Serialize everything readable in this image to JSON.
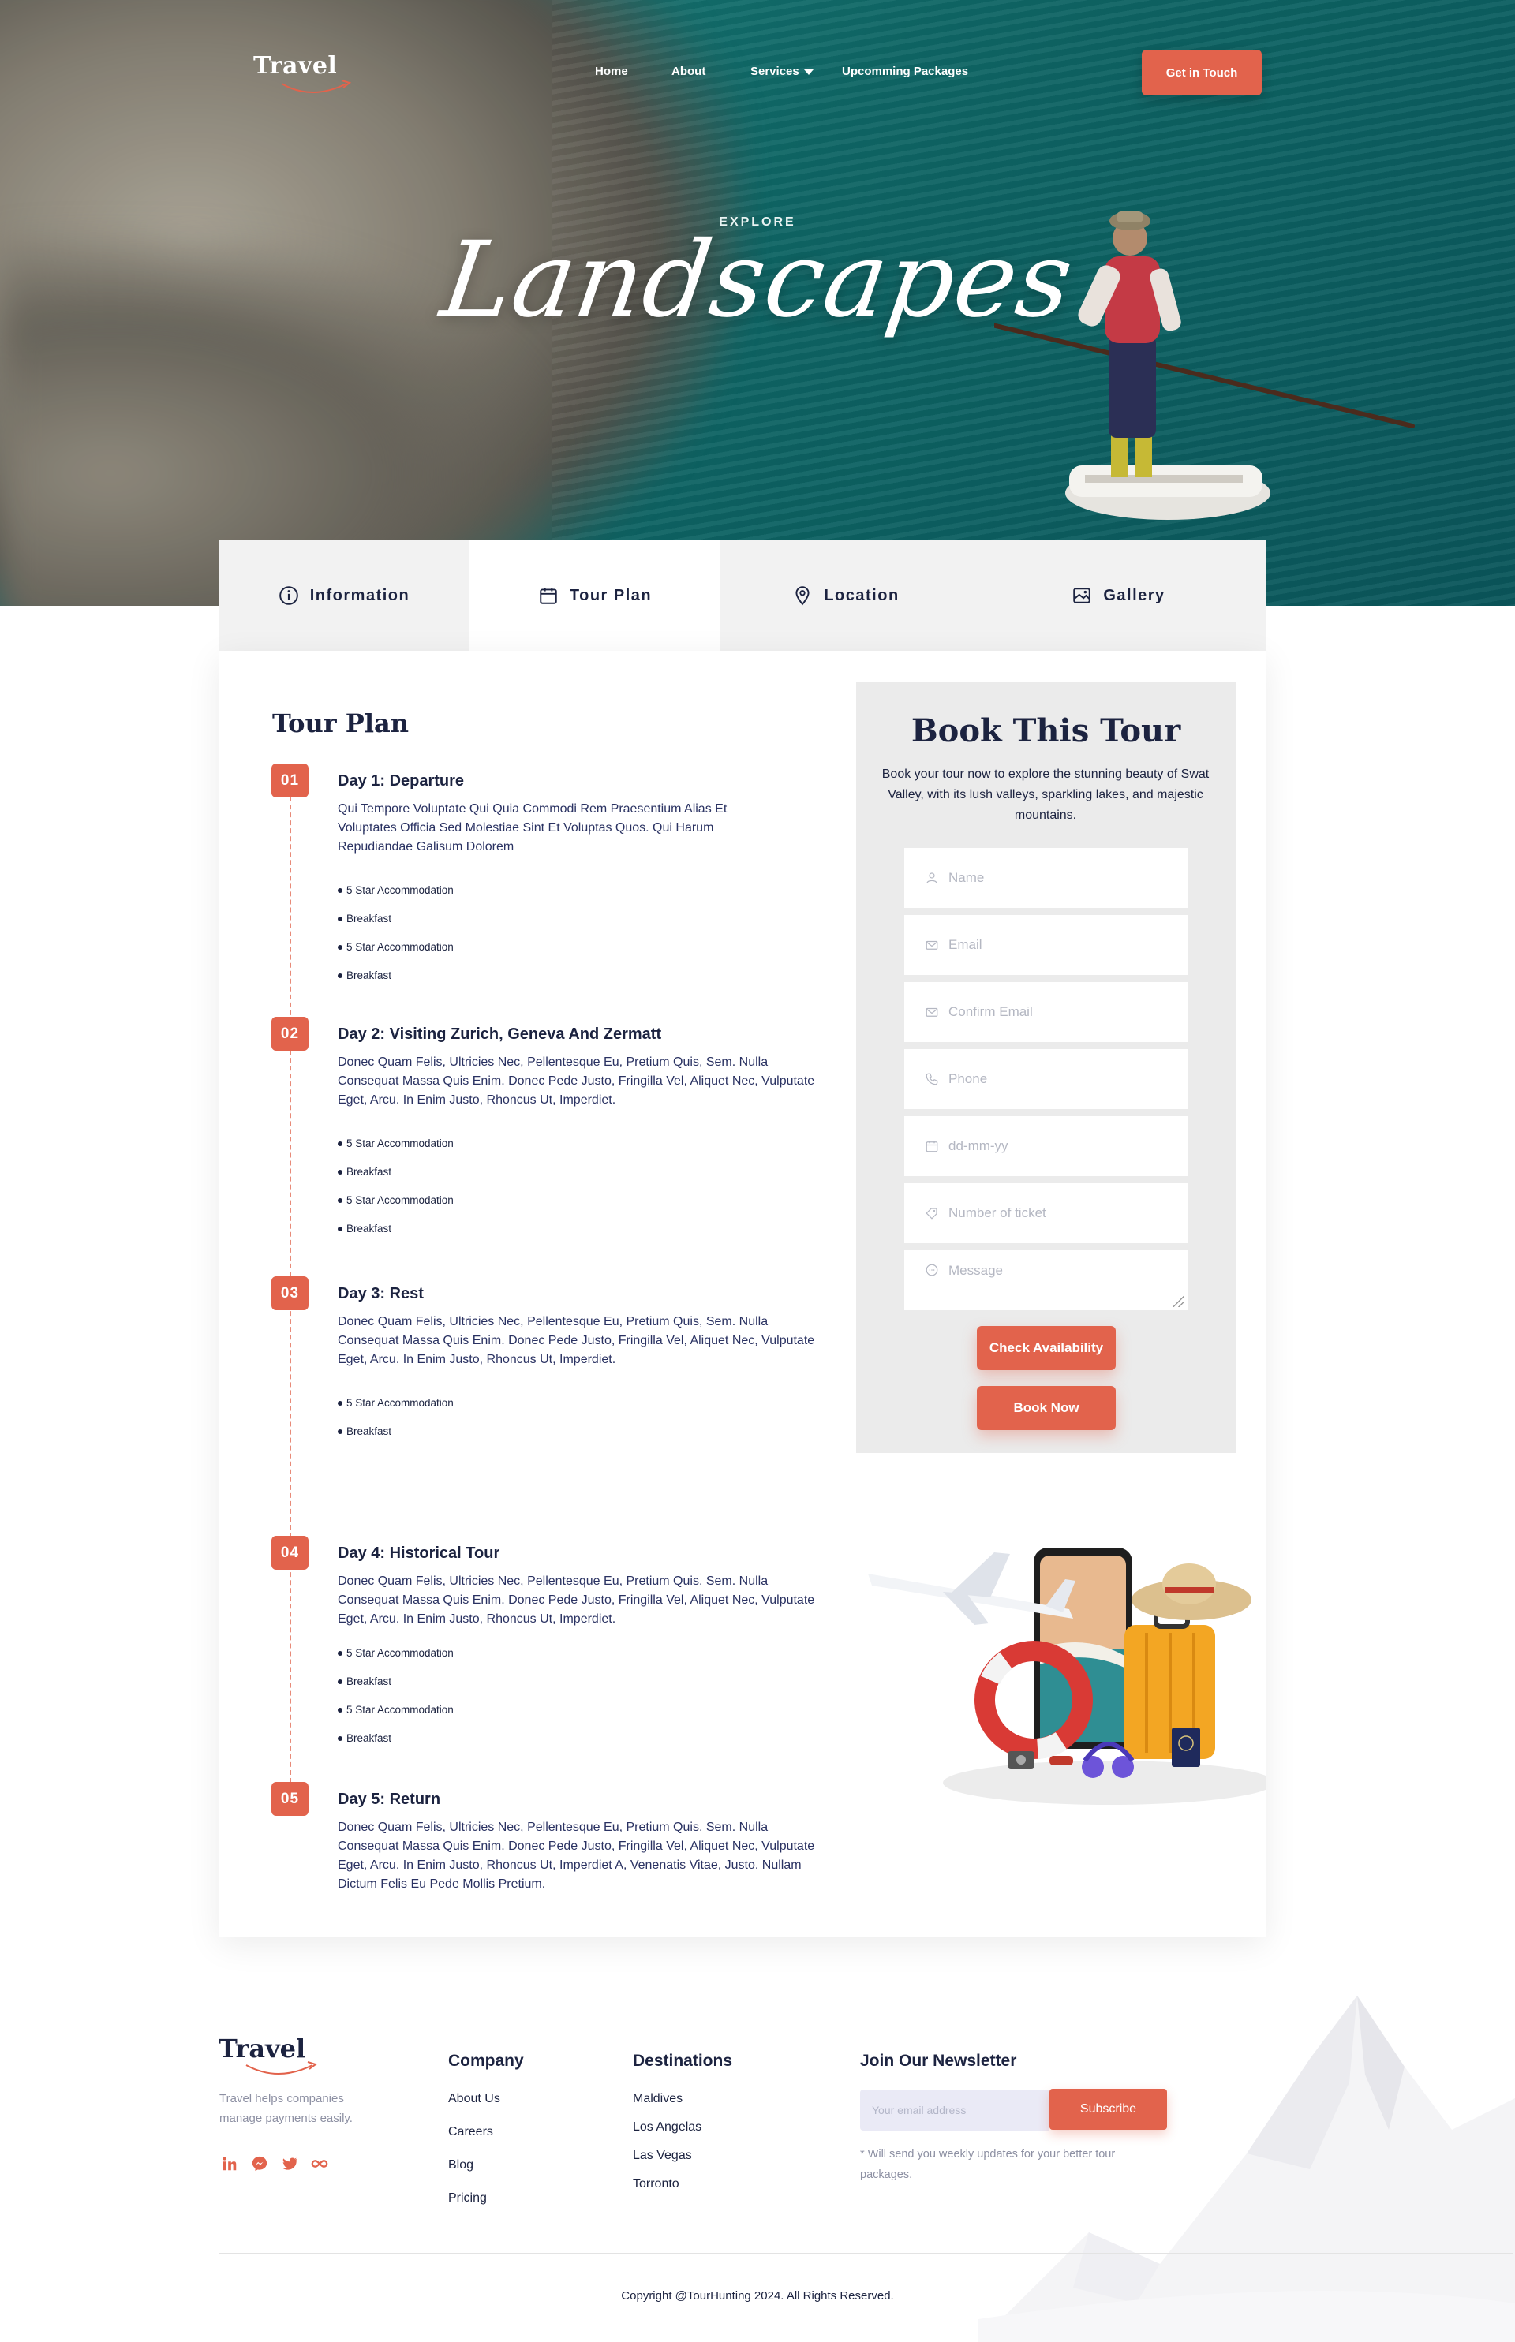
{
  "header": {
    "logo": "Travel",
    "nav": [
      {
        "label": "Home"
      },
      {
        "label": "About"
      },
      {
        "label": "Services"
      },
      {
        "label": "Upcomming Packages"
      }
    ],
    "cta": "Get in Touch"
  },
  "hero": {
    "eyebrow": "EXPLORE",
    "title": "Landscapes"
  },
  "tabs": [
    {
      "label": "Information",
      "icon": "info-icon",
      "active": false
    },
    {
      "label": "Tour Plan",
      "icon": "calendar-icon",
      "active": true
    },
    {
      "label": "Location",
      "icon": "map-pin-icon",
      "active": false
    },
    {
      "label": "Gallery",
      "icon": "gallery-icon",
      "active": false
    }
  ],
  "tour_plan": {
    "title": "Tour Plan",
    "days": [
      {
        "number": "01",
        "title": "Day 1: Departure",
        "description": "Qui Tempore Voluptate Qui Quia Commodi Rem Praesentium Alias Et Voluptates Officia Sed Molestiae Sint Et Voluptas Quos. Qui Harum Repudiandae Galisum Dolorem",
        "bullets": [
          "5 Star Accommodation",
          "Breakfast",
          "5 Star Accommodation",
          "Breakfast"
        ]
      },
      {
        "number": "02",
        "title": "Day 2: Visiting Zurich, Geneva And Zermatt",
        "description": "Donec Quam Felis, Ultricies Nec, Pellentesque Eu, Pretium Quis, Sem. Nulla Consequat Massa Quis Enim. Donec Pede Justo, Fringilla Vel, Aliquet Nec, Vulputate Eget, Arcu. In Enim Justo, Rhoncus Ut, Imperdiet.",
        "bullets": [
          "5 Star Accommodation",
          "Breakfast",
          "5 Star Accommodation",
          "Breakfast"
        ]
      },
      {
        "number": "03",
        "title": "Day 3: Rest",
        "description": "Donec Quam Felis, Ultricies Nec, Pellentesque Eu, Pretium Quis, Sem. Nulla Consequat Massa Quis Enim. Donec Pede Justo, Fringilla Vel, Aliquet Nec, Vulputate Eget, Arcu. In Enim Justo, Rhoncus Ut, Imperdiet.",
        "bullets": [
          "5 Star Accommodation",
          "Breakfast"
        ]
      },
      {
        "number": "04",
        "title": "Day 4: Historical Tour",
        "description": "Donec Quam Felis, Ultricies Nec, Pellentesque Eu, Pretium Quis, Sem. Nulla Consequat Massa Quis Enim. Donec Pede Justo, Fringilla Vel, Aliquet Nec, Vulputate Eget, Arcu. In Enim Justo, Rhoncus Ut, Imperdiet.",
        "bullets": [
          "5 Star Accommodation",
          "Breakfast",
          "5 Star Accommodation",
          "Breakfast"
        ]
      },
      {
        "number": "05",
        "title": "Day 5: Return",
        "description": "Donec Quam Felis, Ultricies Nec, Pellentesque Eu, Pretium Quis, Sem. Nulla Consequat Massa Quis Enim. Donec Pede Justo, Fringilla Vel, Aliquet Nec, Vulputate Eget, Arcu. In Enim Justo, Rhoncus Ut, Imperdiet A, Venenatis Vitae, Justo. Nullam Dictum Felis Eu Pede Mollis Pretium.",
        "bullets": []
      }
    ]
  },
  "booking": {
    "title": "Book This Tour",
    "subtitle": "Book your tour now to explore the stunning beauty of Swat Valley, with its lush valleys, sparkling lakes, and majestic mountains.",
    "fields": [
      {
        "placeholder": "Name",
        "icon": "user-icon"
      },
      {
        "placeholder": "Email",
        "icon": "mail-icon"
      },
      {
        "placeholder": "Confirm Email",
        "icon": "mail-icon"
      },
      {
        "placeholder": "Phone",
        "icon": "phone-icon"
      },
      {
        "placeholder": "dd-mm-yy",
        "icon": "calendar-icon"
      },
      {
        "placeholder": "Number of ticket",
        "icon": "ticket-icon"
      },
      {
        "placeholder": "Message",
        "icon": "chat-icon"
      }
    ],
    "check_label": "Check Availability",
    "book_label": "Book Now"
  },
  "footer": {
    "logo": "Travel",
    "tagline": "Travel helps companies manage payments easily.",
    "socials": [
      "linkedin-icon",
      "messenger-icon",
      "twitter-icon",
      "infinity-icon"
    ],
    "company": {
      "title": "Company",
      "links": [
        "About Us",
        "Careers",
        "Blog",
        "Pricing"
      ]
    },
    "destinations": {
      "title": "Destinations",
      "links": [
        "Maldives",
        "Los Angelas",
        "Las Vegas",
        "Torronto"
      ]
    },
    "newsletter": {
      "title": "Join Our Newsletter",
      "placeholder": "Your email address",
      "button": "Subscribe",
      "note": "* Will send you weekly updates for your better tour packages."
    },
    "copyright": "Copyright @TourHunting 2024. All Rights Reserved."
  },
  "colors": {
    "accent": "#e2634c",
    "navy": "#1c2340",
    "panel": "#ebebeb"
  }
}
